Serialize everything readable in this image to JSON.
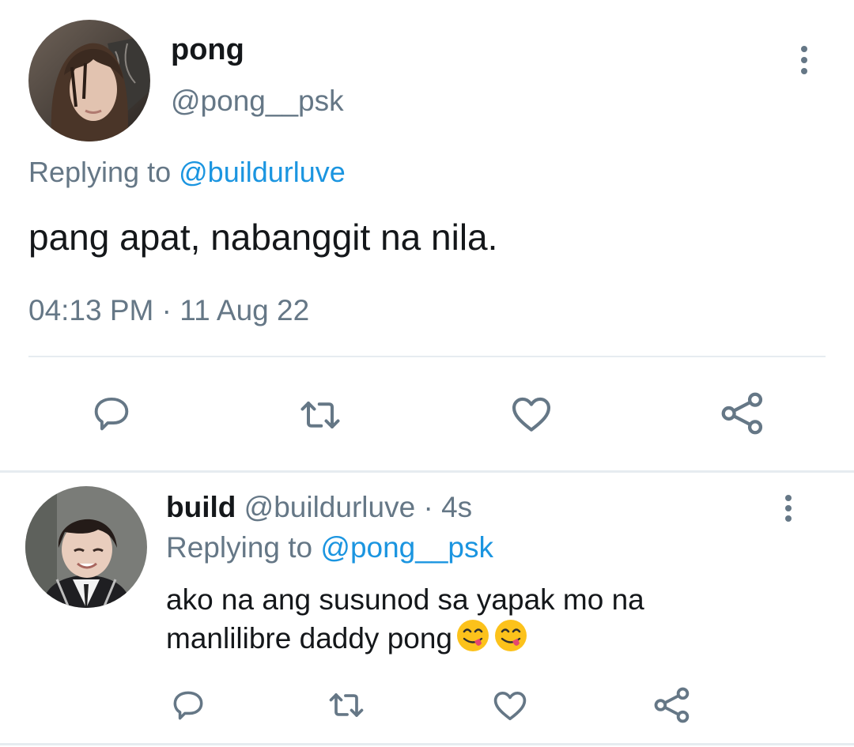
{
  "main_tweet": {
    "display_name": "pong",
    "handle": "@pong__psk",
    "replying_prefix": "Replying to",
    "replying_to": "@buildurluve",
    "text": "pang apat, nabanggit na nila.",
    "timestamp": "04:13 PM · 11 Aug 22",
    "actions": [
      "reply-icon",
      "retweet-icon",
      "like-icon",
      "share-icon"
    ]
  },
  "reply_tweet": {
    "display_name": "build",
    "handle": "@buildurluve",
    "separator": "·",
    "time_ago": "4s",
    "replying_prefix": "Replying to",
    "replying_to": "@pong__psk",
    "text": "ako na ang susunod sa yapak mo na manlilibre daddy pong",
    "emojis": [
      "yum-face-emoji",
      "yum-face-emoji"
    ],
    "actions": [
      "reply-icon",
      "retweet-icon",
      "like-icon",
      "share-icon"
    ]
  },
  "colors": {
    "text": "#14171a",
    "muted": "#657786",
    "link": "#1b95e0",
    "divider": "#e6ecf0"
  }
}
